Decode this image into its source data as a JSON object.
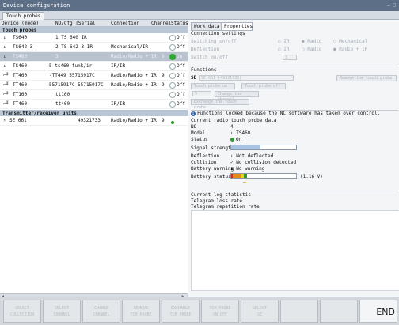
{
  "window": {
    "title": "Device configuration",
    "controls": "— □"
  },
  "main_tab": "Touch probes",
  "table": {
    "headers": {
      "device": "Device (mode)",
      "serial": "NO/CfgTTSerial",
      "connection": "Connection",
      "channel": "Channel",
      "status": "Status"
    },
    "group_probes": "Touch probes",
    "rows": [
      {
        "icon": "↓",
        "device": "TS640",
        "serial": "1 TS 640 IR",
        "connection": "",
        "channel": "",
        "status": "Off",
        "on": false,
        "selected": false
      },
      {
        "icon": "↓",
        "device": "TS642-3",
        "serial": "2 TS 642-3 IR",
        "connection": "Mechanical/IR",
        "channel": "",
        "status": "Off",
        "on": false,
        "selected": false
      },
      {
        "icon": "↓",
        "device": "TS460",
        "serial": "3",
        "connection": "Radio/Radio + IR",
        "channel": "9",
        "status": "On",
        "on": true,
        "selected": true
      },
      {
        "icon": "↓",
        "device": "TS460",
        "serial": "5 ts460 funk/ir",
        "connection": "IR/IR",
        "channel": "",
        "status": "Off",
        "on": false,
        "selected": false
      },
      {
        "icon": "⌐╜",
        "device": "TT460",
        "serial": "-TT449 55715917C",
        "connection": "Radio/Radio + IR",
        "channel": "9",
        "status": "Off",
        "on": false,
        "selected": false
      },
      {
        "icon": "⌐╜",
        "device": "TT460",
        "serial": "55715917C 55715917C",
        "connection": "Radio/Radio + IR",
        "channel": "9",
        "status": "Off",
        "on": false,
        "selected": false
      },
      {
        "icon": "⌐╜",
        "device": "TT160",
        "serial": "tt160",
        "connection": "",
        "channel": "",
        "status": "Off",
        "on": false,
        "selected": false
      },
      {
        "icon": "⌐╜",
        "device": "TT460",
        "serial": "tt460",
        "connection": "IR/IR",
        "channel": "",
        "status": "Off",
        "on": false,
        "selected": false
      }
    ],
    "group_units": "Transmitter/receiver units",
    "unit_row": {
      "icon": "⚡",
      "device": "SE 661",
      "serial": "49321733",
      "connection": "Radio/Radio + IR",
      "channel": "9",
      "on": true
    }
  },
  "right": {
    "tabs": [
      "Work data",
      "Properties"
    ],
    "connection_settings": {
      "title": "Connection settings",
      "switching_on_label": "Switching on/off",
      "deflection_label": "Deflection",
      "switch_on_off_label": "Switch on/off",
      "ir": "IR",
      "radio": "Radio",
      "mechanical": "Mechanical",
      "radio_ir": "Radio + IR",
      "switch_value": "3"
    },
    "functions": {
      "title": "Functions",
      "se_label": "SE",
      "se_value": "SE 661 (49321733)",
      "remove_button": "Remove the touch probe",
      "probe_on_button": "Touch probe on",
      "probe_off_button": "Touch probe off",
      "channel_value": "9",
      "change_channel_button": "Change the channel",
      "exchange_button": "Exchange the touch probe",
      "info_message": "Functions locked because the NC software has taken over control."
    },
    "radio_data": {
      "title": "Current radio touch probe data",
      "no_label": "NO",
      "no_value": "4",
      "model_label": "Model",
      "model_value": "TS460",
      "status_label": "Status",
      "status_value": "On",
      "signal_label": "Signal strength",
      "signal_fraction": 0.45,
      "deflection_label": "Deflection",
      "deflection_value": "Not deflected",
      "collision_label": "Collision",
      "collision_value": "No collision detected",
      "battery_warning_label": "Battery warning",
      "battery_warning_value": "No warning",
      "battery_status_label": "Battery status",
      "battery_status_value": "(1.16 V)"
    },
    "log": {
      "title": "Current log statistic",
      "loss_label": "Telegram loss rate",
      "repetition_label": "Telegram repetition rate"
    }
  },
  "softkeys": [
    "SELECT\nCOLLECTION",
    "SELECT\nCHANNEL",
    "CHANGE\nCHANNEL",
    "REMOVE\nTCH PROBE",
    "EXCHANGE\nTCH PROBE",
    "TCH PROBE\nON    OFF",
    "SELECT\nSE",
    "",
    "",
    "END"
  ]
}
